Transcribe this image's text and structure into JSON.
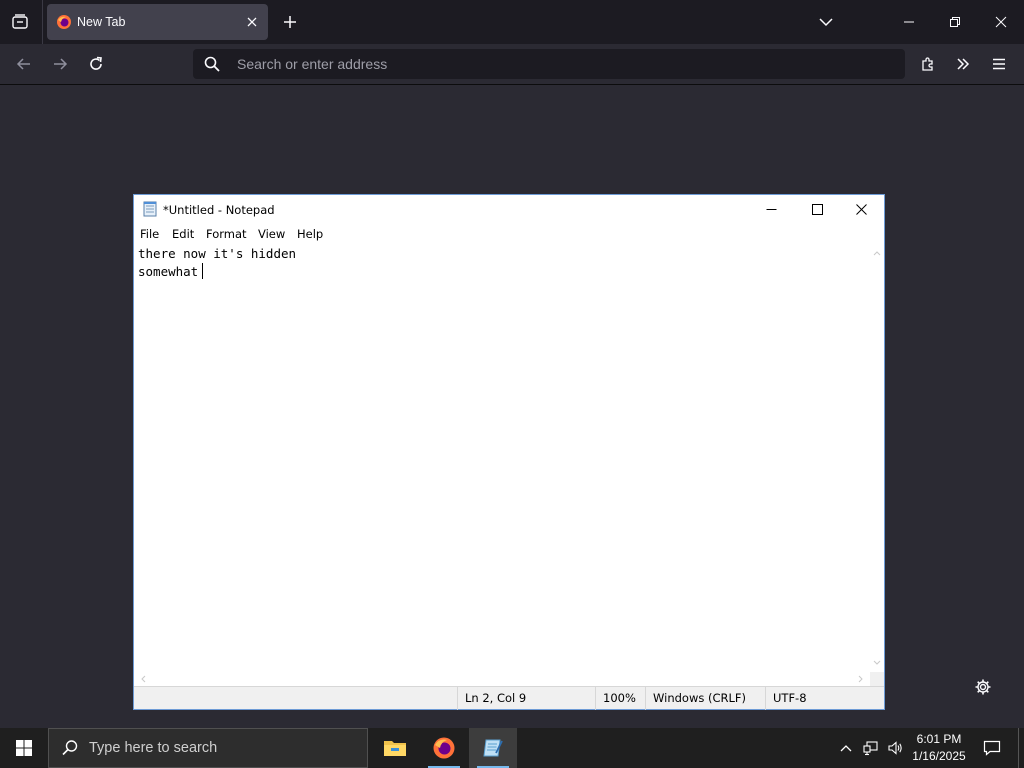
{
  "browser": {
    "tab": {
      "title": "New Tab"
    },
    "urlbar": {
      "placeholder": "Search or enter address"
    }
  },
  "notepad": {
    "title": "*Untitled - Notepad",
    "menu": [
      "File",
      "Edit",
      "Format",
      "View",
      "Help"
    ],
    "content_lines": [
      "there now it's hidden",
      "somewhat"
    ],
    "status": {
      "position": "Ln 2, Col 9",
      "zoom": "100%",
      "line_ending": "Windows (CRLF)",
      "encoding": "UTF-8"
    }
  },
  "taskbar": {
    "search_placeholder": "Type here to search",
    "time": "6:01 PM",
    "date": "1/16/2025"
  },
  "colors": {
    "firefox_dark_bg": "#2b2a33",
    "tab_active_bg": "#42414d",
    "taskbar_bg": "#1f1f1f",
    "accent_blue": "#76b9ed"
  }
}
